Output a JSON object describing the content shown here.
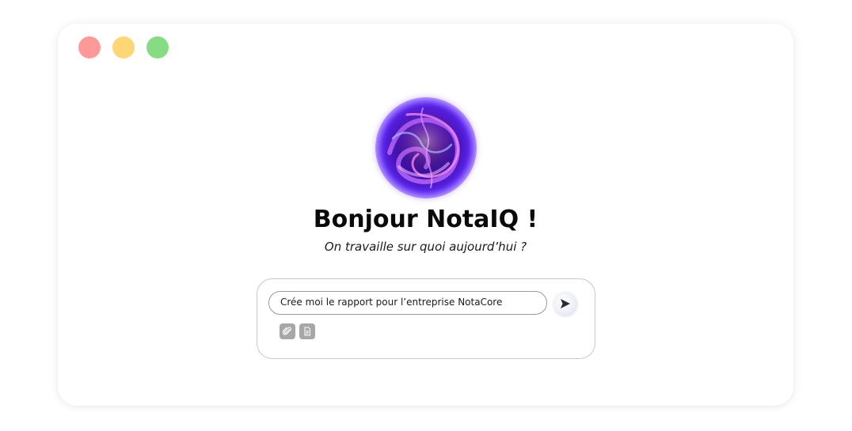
{
  "window": {
    "controls": [
      {
        "name": "close",
        "color": "#ff9a98"
      },
      {
        "name": "minimize",
        "color": "#ffd676"
      },
      {
        "name": "maximize",
        "color": "#86dc83"
      }
    ]
  },
  "hero": {
    "avatar_icon": "plasma-orb-icon",
    "title": "Bonjour NotaIQ !",
    "subtitle": "On travaille sur quoi aujourd’hui ?"
  },
  "chat": {
    "input_value": "Crée moi le rapport pour l’entreprise NotaCore",
    "send_icon": "send-arrow-icon",
    "tools": [
      {
        "name": "attach",
        "icon": "paperclip-icon"
      },
      {
        "name": "document",
        "icon": "document-icon"
      }
    ]
  },
  "colors": {
    "orb_primary": "#6a1fe0",
    "orb_accent": "#e9a3ff",
    "tool_button": "#a7a7a7",
    "input_border": "#9a9a9a"
  }
}
